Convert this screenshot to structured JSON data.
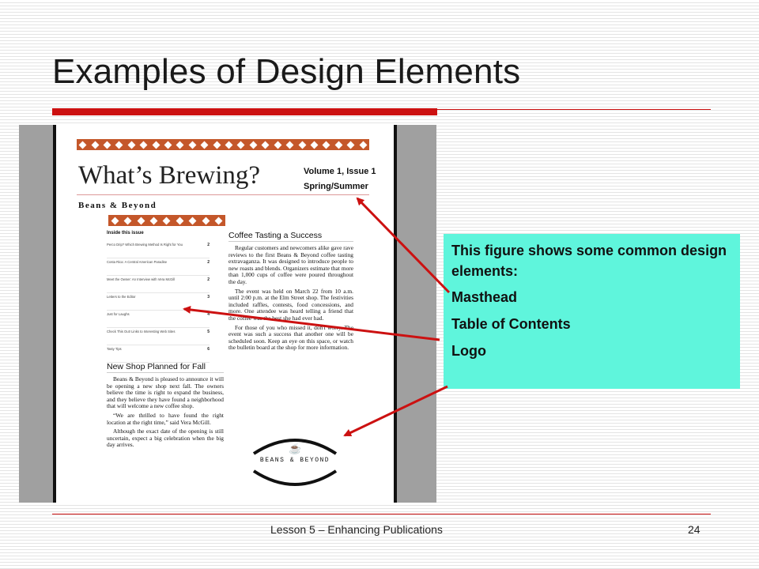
{
  "slide": {
    "title": "Examples of Design Elements",
    "footer": "Lesson 5 – Enhancing Publications",
    "page_number": "24"
  },
  "callout": {
    "intro": "This figure shows some common design elements:",
    "items": [
      "Masthead",
      "Table of Contents",
      "Logo"
    ]
  },
  "newsletter": {
    "title": "What’s Brewing?",
    "volume": "Volume 1, Issue 1",
    "season": "Spring/Summer",
    "brand": "Beans & Beyond",
    "toc": {
      "heading": "Inside this issue",
      "rows": [
        {
          "label": "Perco Drip? Which Brewing Method Is Right for You",
          "page": "2"
        },
        {
          "label": "Costa Rica: A Central American Paradise",
          "page": "2"
        },
        {
          "label": "Meet the Owner: An Interview with Vera McGill",
          "page": "2"
        },
        {
          "label": "Letters to the Editor",
          "page": "3"
        },
        {
          "label": "Just for Laughs",
          "page": "4"
        },
        {
          "label": "Check This Out! Links to Interesting Web Sites",
          "page": "5"
        },
        {
          "label": "Tasty Tips",
          "page": "6"
        }
      ]
    },
    "article1": {
      "title": "Coffee Tasting a Success",
      "p1": "Regular customers and newcomers alike gave rave reviews to the first Beans & Beyond coffee tasting extravaganza. It was designed to introduce people to new roasts and blends. Organizers estimate that more than 1,000 cups of coffee were poured throughout the day.",
      "p2": "The event was held on March 22 from 10 a.m. until 2:00 p.m. at the Elm Street shop. The festivities included raffles, contests, food concessions, and more. One attendee was heard telling a friend that the coffee was the best she had ever had.",
      "p3": "For those of you who missed it, don't worry. The event was such a success that another one will be scheduled soon. Keep an eye on this space, or watch the bulletin board at the shop for more information."
    },
    "article2": {
      "title": "New Shop Planned for Fall",
      "p1": "Beans & Beyond is pleased to announce it will be opening a new shop next fall. The owners believe the time is right to expand the business, and they believe they have found a neighborhood that will welcome a new coffee shop.",
      "p2": "“We are thrilled to have found the right location at the right time,” said Vera McGill.",
      "p3": "Although the exact date of the opening is still uncertain, expect a big celebration when the big day arrives."
    },
    "logo_text": "BEANS & BEYOND"
  },
  "colors": {
    "accent_red": "#cc1111",
    "callout_bg": "#5ff5dc",
    "ornament": "#c4572a",
    "figure_gray": "#a0a0a0"
  }
}
